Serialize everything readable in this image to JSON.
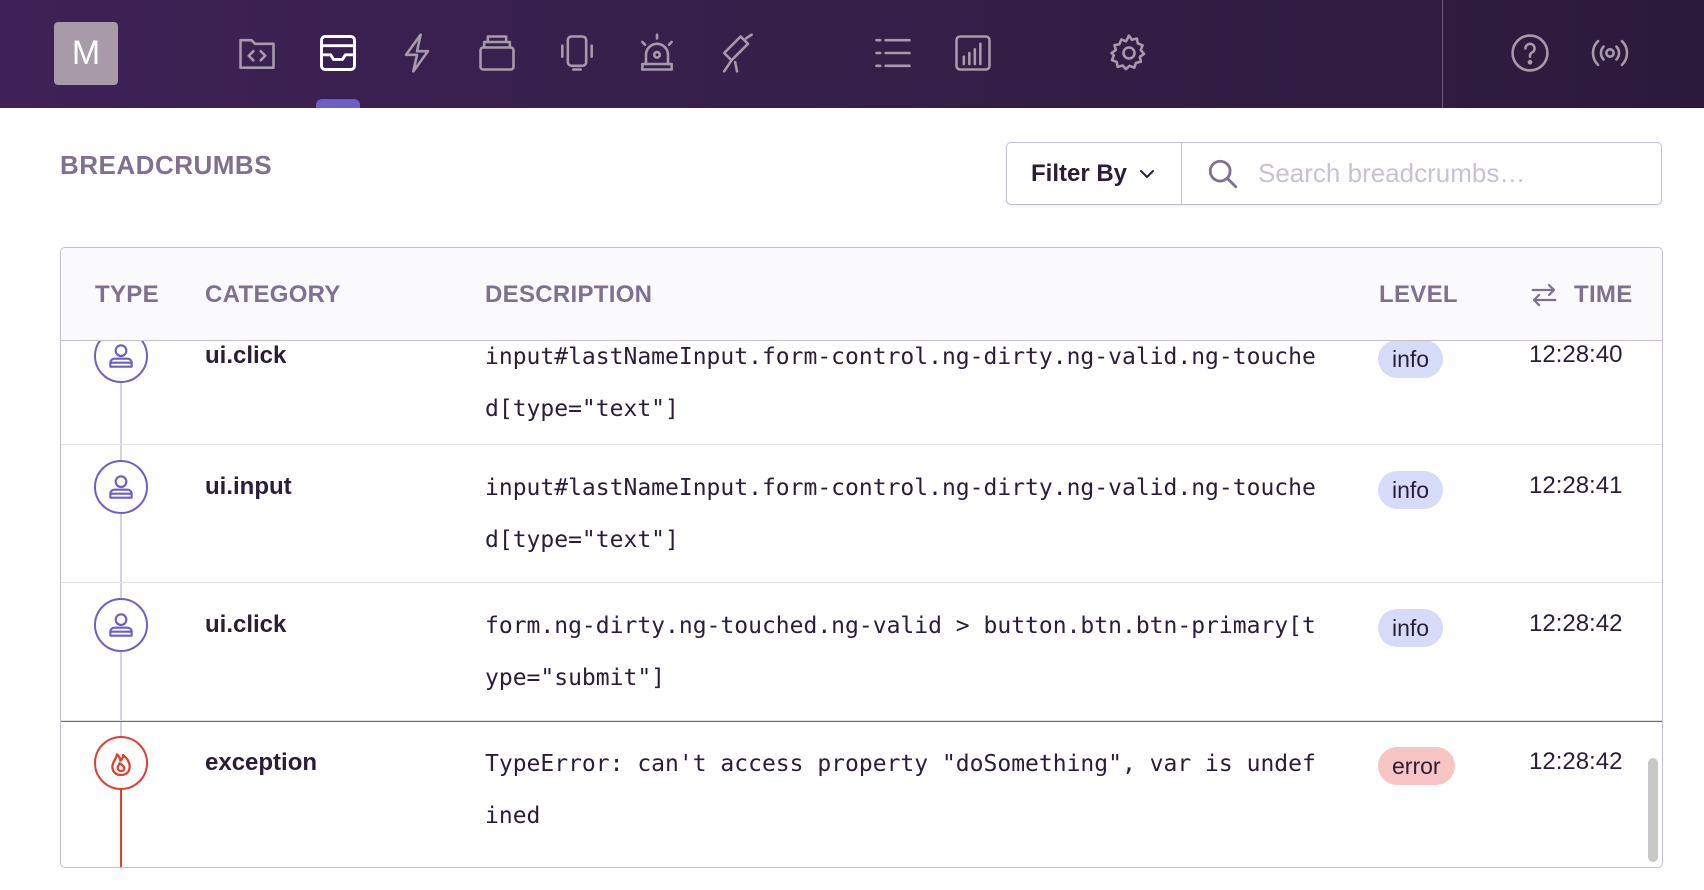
{
  "topbar": {
    "avatar_letter": "M",
    "nav_icons": [
      "code-file-icon",
      "issues-icon",
      "performance-icon",
      "releases-icon",
      "user-feedback-icon",
      "alerts-icon",
      "discover-icon",
      "list-icon",
      "stats-icon",
      "settings-icon",
      "help-icon",
      "broadcast-icon"
    ]
  },
  "breadcrumbs": {
    "title": "BREADCRUMBS",
    "filter_label": "Filter By",
    "search_placeholder": "Search breadcrumbs…",
    "columns": {
      "type": "TYPE",
      "category": "CATEGORY",
      "description": "DESCRIPTION",
      "level": "LEVEL",
      "time": "TIME"
    },
    "rows": [
      {
        "type_icon": "user-icon",
        "category": "ui.click",
        "description": "input#lastNameInput.form-control.ng-dirty.ng-valid.ng-touched[type=\"text\"]",
        "level": "info",
        "time": "12:28:40"
      },
      {
        "type_icon": "user-icon",
        "category": "ui.input",
        "description": "input#lastNameInput.form-control.ng-dirty.ng-valid.ng-touched[type=\"text\"]",
        "level": "info",
        "time": "12:28:41"
      },
      {
        "type_icon": "user-icon",
        "category": "ui.click",
        "description": "form.ng-dirty.ng-touched.ng-valid > button.btn.btn-primary[type=\"submit\"]",
        "level": "info",
        "time": "12:28:42"
      },
      {
        "type_icon": "fire-icon",
        "category": "exception",
        "description": "TypeError: can't access property \"doSomething\", var is undefined",
        "level": "error",
        "time": "12:28:42"
      }
    ]
  },
  "colors": {
    "topbar": "#3e2156",
    "accent": "#6c5fc7",
    "error": "#e03e2f",
    "info_pill": "#d6dcf7",
    "error_pill": "#f8c5c5"
  }
}
